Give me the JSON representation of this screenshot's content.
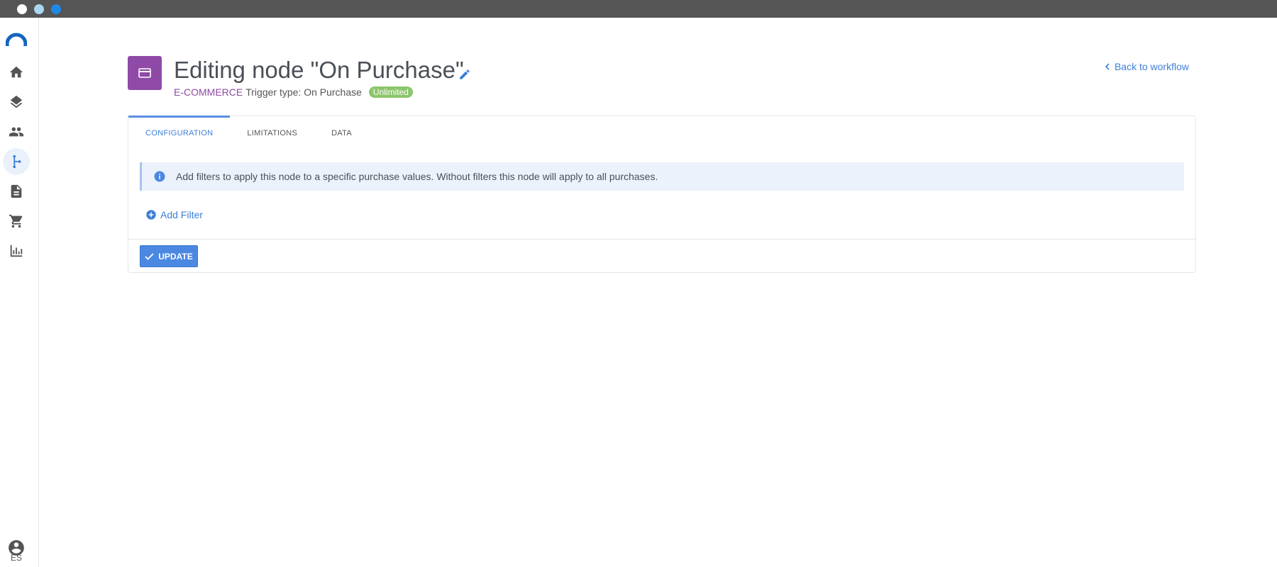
{
  "window": {
    "close_color": "#ffffff",
    "minimize_color": "#a9d6f0",
    "maximize_color": "#1e88e5"
  },
  "sidebar": {
    "items": [
      {
        "icon": "home-icon"
      },
      {
        "icon": "layers-icon"
      },
      {
        "icon": "people-icon"
      },
      {
        "icon": "workflow-icon",
        "active": true
      },
      {
        "icon": "document-icon"
      },
      {
        "icon": "cart-icon"
      },
      {
        "icon": "bar-chart-icon"
      }
    ],
    "language": "ES"
  },
  "header": {
    "title": "Editing node \"On Purchase\"",
    "category": "E-COMMERCE",
    "trigger": "Trigger type: On Purchase",
    "badge": "Unlimited",
    "back_link": "Back to workflow"
  },
  "tabs": [
    {
      "label": "CONFIGURATION",
      "active": true
    },
    {
      "label": "LIMITATIONS",
      "active": false
    },
    {
      "label": "DATA",
      "active": false
    }
  ],
  "info_message": "Add filters to apply this node to a specific purchase values. Without filters this node will apply to all purchases.",
  "add_filter_label": "Add Filter",
  "update_label": "UPDATE",
  "colors": {
    "accent": "#4a88e2",
    "brand": "#8e4aa6",
    "badge": "#8cc66a"
  }
}
